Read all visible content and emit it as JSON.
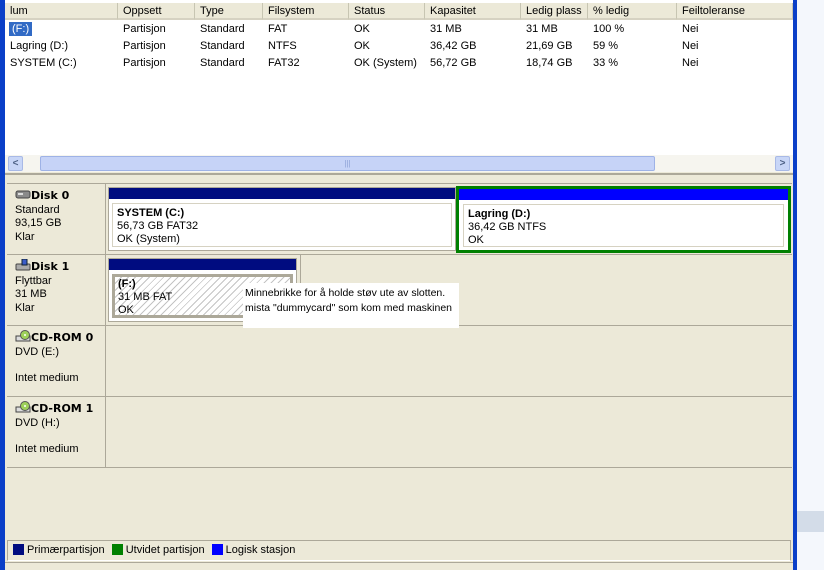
{
  "columns": [
    "lum",
    "Oppsett",
    "Type",
    "Filsystem",
    "Status",
    "Kapasitet",
    "Ledig plass",
    "% ledig",
    "Feiltoleranse"
  ],
  "volumes": [
    [
      "(F:)",
      "Partisjon",
      "Standard",
      "FAT",
      "OK",
      "31 MB",
      "31 MB",
      "100 %",
      "Nei"
    ],
    [
      "Lagring (D:)",
      "Partisjon",
      "Standard",
      "NTFS",
      "OK",
      "36,42 GB",
      "21,69 GB",
      "59 %",
      "Nei"
    ],
    [
      "SYSTEM (C:)",
      "Partisjon",
      "Standard",
      "FAT32",
      "OK (System)",
      "56,72 GB",
      "18,74 GB",
      "33 %",
      "Nei"
    ]
  ],
  "scroll": {
    "left": "<",
    "right": ">",
    "grip": "|||"
  },
  "disks": [
    {
      "name": "Disk 0",
      "type": "Standard",
      "size": "93,15 GB",
      "status": "Klar",
      "icon": "hard-disk-icon"
    },
    {
      "name": "Disk 1",
      "type": "Flyttbar",
      "size": "31 MB",
      "status": "Klar",
      "icon": "removable-disk-icon"
    },
    {
      "name": "CD-ROM 0",
      "type": "DVD (E:)",
      "size": "",
      "status": "Intet medium",
      "icon": "cdrom-icon"
    },
    {
      "name": "CD-ROM 1",
      "type": "DVD (H:)",
      "size": "",
      "status": "Intet medium",
      "icon": "cdrom-icon"
    }
  ],
  "partitions": {
    "c": {
      "name": "SYSTEM  (C:)",
      "info": "56,73 GB FAT32",
      "status": "OK (System)"
    },
    "d": {
      "name": "Lagring  (D:)",
      "info": "36,42 GB NTFS",
      "status": "OK"
    },
    "f": {
      "name": " (F:)",
      "info": "31 MB FAT",
      "status": "OK"
    }
  },
  "tooltip": {
    "line1": "Minnebrikke for å holde støv ute av slotten.",
    "line2": "mista \"dummycard\" som kom med maskinen"
  },
  "legend": [
    {
      "label": "Primærpartisjon",
      "color": "#000c80"
    },
    {
      "label": "Utvidet partisjon",
      "color": "#008000"
    },
    {
      "label": "Logisk stasjon",
      "color": "#0000ff"
    }
  ],
  "colors": {
    "primary": "#000c80",
    "logical": "#0000ff",
    "extended": "#008000"
  }
}
